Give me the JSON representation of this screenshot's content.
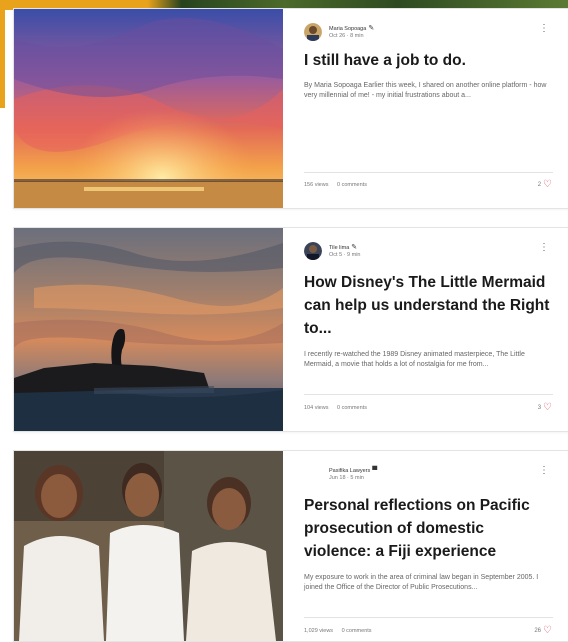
{
  "posts": [
    {
      "author": "Maria Sopoaga",
      "date": "Oct 26",
      "read_time": "8 min",
      "title": "I still have a job to do.",
      "excerpt": "By Maria Sopoaga Earlier this week, I shared on another online platform - how very millennial of me! - my initial frustrations about a...",
      "views": "156 views",
      "comments": "0 comments",
      "likes": "2"
    },
    {
      "author": "Tile lima",
      "date": "Oct 5",
      "read_time": "9 min",
      "title": "How Disney's The Little Mermaid can help us understand the Right to...",
      "excerpt": "I recently re-watched the 1989 Disney animated masterpiece, The Little Mermaid, a movie that holds a lot of nostalgia for me from...",
      "views": "104 views",
      "comments": "0 comments",
      "likes": "3"
    },
    {
      "author": "Pasifika Lawyers",
      "date": "Jun 18",
      "read_time": "5 min",
      "title": "Personal reflections on Pacific prosecution of domestic violence: a Fiji experience",
      "excerpt": "My exposure to work in the area of criminal law began in September 2005. I joined the Office of the Director of Public Prosecutions...",
      "views": "1,029 views",
      "comments": "0 comments",
      "likes": "26"
    }
  ],
  "icons": {
    "more": "more-vertical-icon",
    "heart": "heart-icon",
    "writer_badge": "pen-icon",
    "admin_badge": "crown-icon"
  },
  "colors": {
    "heart": "#e0445a",
    "accent": "#e8a21c"
  }
}
